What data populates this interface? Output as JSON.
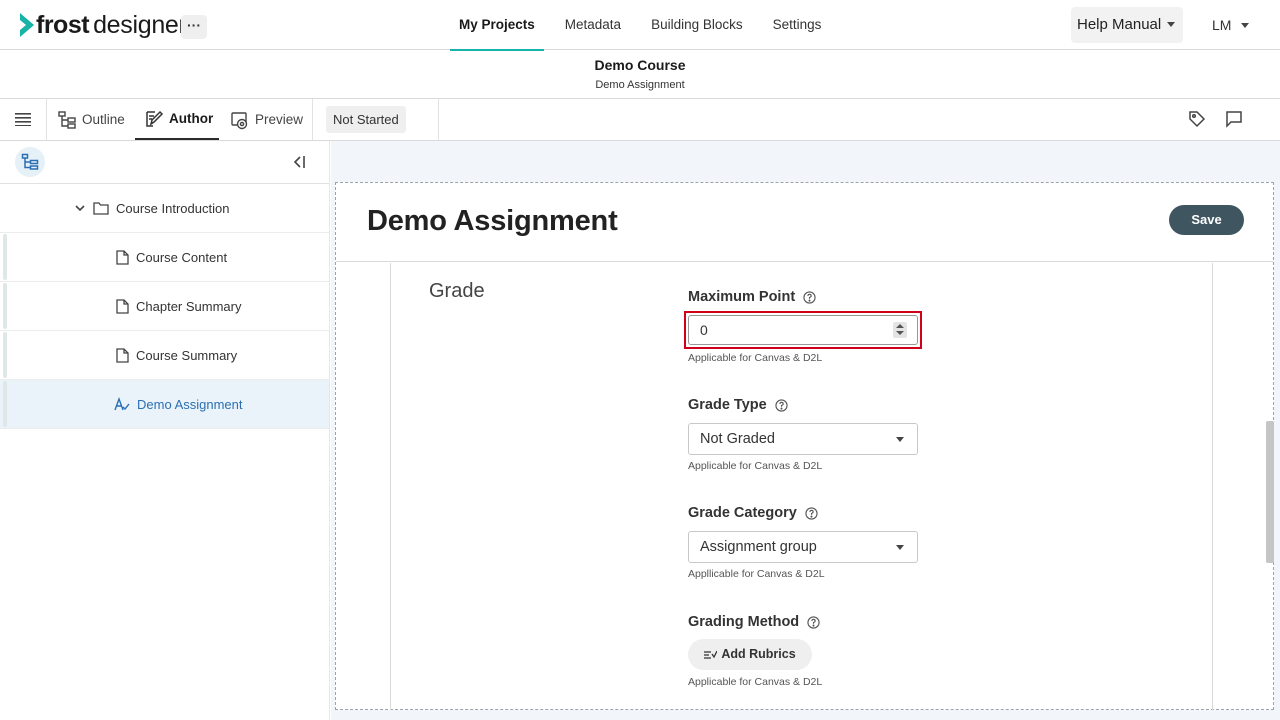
{
  "app": {
    "logo_bold": "frost",
    "logo_light": "designer",
    "more_label": "···",
    "nav": [
      {
        "label": "My Projects",
        "active": true
      },
      {
        "label": "Metadata"
      },
      {
        "label": "Building Blocks"
      },
      {
        "label": "Settings"
      }
    ],
    "help_label": "Help Manual",
    "user_initials": "LM",
    "accent_color": "#16b3a6"
  },
  "course": {
    "title": "Demo Course",
    "subtitle": "Demo Assignment"
  },
  "toolbar": {
    "tabs": [
      {
        "label": "Outline",
        "icon": "outline-tree-icon"
      },
      {
        "label": "Author",
        "icon": "author-edit-icon",
        "active": true
      },
      {
        "label": "Preview",
        "icon": "preview-eye-icon"
      }
    ],
    "status": "Not Started"
  },
  "sidebar": {
    "folder": {
      "label": "Course Introduction",
      "icon": "folder-icon"
    },
    "items": [
      {
        "label": "Course Content",
        "icon": "document-icon"
      },
      {
        "label": "Chapter Summary",
        "icon": "document-icon"
      },
      {
        "label": "Course Summary",
        "icon": "document-icon"
      },
      {
        "label": "Demo Assignment",
        "icon": "assignment-icon",
        "selected": true
      }
    ]
  },
  "panel": {
    "title": "Demo Assignment",
    "save_label": "Save",
    "section": "Grade",
    "fields": {
      "max_point": {
        "label": "Maximum Point",
        "value": "0",
        "hint": "Applicable for Canvas & D2L"
      },
      "grade_type": {
        "label": "Grade Type",
        "value": "Not Graded",
        "hint": "Applicable for Canvas & D2L"
      },
      "grade_category": {
        "label": "Grade Category",
        "value": "Assignment group",
        "hint": "Appllicable for Canvas & D2L"
      },
      "grading_method": {
        "label": "Grading Method",
        "button": "Add Rubrics",
        "hint": "Applicable for Canvas & D2L"
      }
    }
  },
  "colors": {
    "save_button": "#3f5560",
    "highlight": "#d0021b",
    "selected_row": "#eaf3fa",
    "selected_text": "#2a6fb3"
  }
}
